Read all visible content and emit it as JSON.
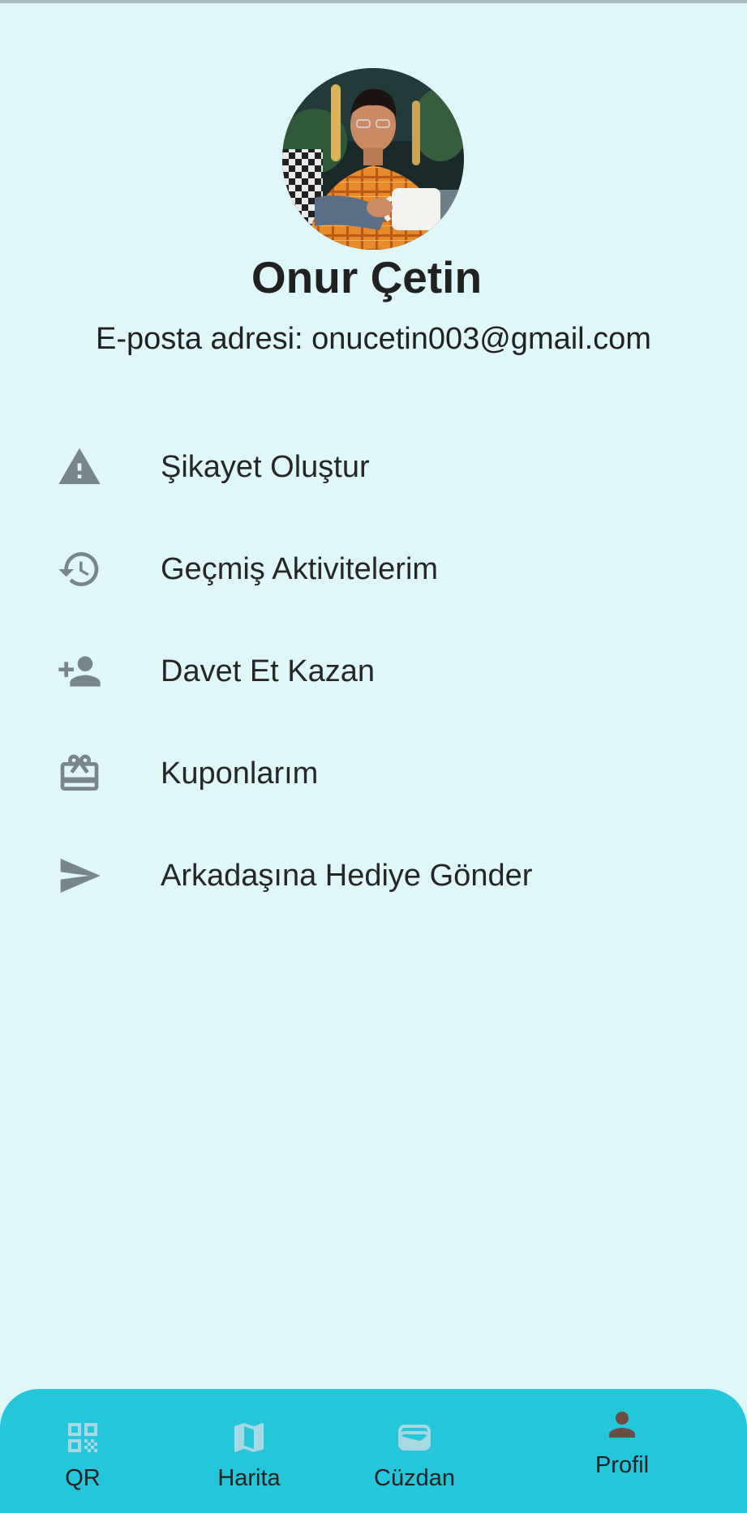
{
  "profile": {
    "name": "Onur Çetin",
    "email_line": "E-posta adresi: onucetin003@gmail.com"
  },
  "menu": {
    "items": [
      {
        "label": "Şikayet Oluştur",
        "icon": "warning-icon"
      },
      {
        "label": "Geçmiş Aktivitelerim",
        "icon": "history-icon"
      },
      {
        "label": "Davet Et Kazan",
        "icon": "person-add-icon"
      },
      {
        "label": "Kuponlarım",
        "icon": "card-giftcard-icon"
      },
      {
        "label": "Arkadaşına Hediye Gönder",
        "icon": "send-icon"
      }
    ]
  },
  "bottom_nav": {
    "items": [
      {
        "label": "QR",
        "icon": "qr-code-icon",
        "selected": false
      },
      {
        "label": "Harita",
        "icon": "map-icon",
        "selected": false
      },
      {
        "label": "Cüzdan",
        "icon": "wallet-icon",
        "selected": false
      },
      {
        "label": "Profil",
        "icon": "person-icon",
        "selected": true
      }
    ]
  },
  "colors": {
    "background": "#e0f7fa",
    "nav_background": "#26c6da",
    "menu_icon": "#78868a",
    "nav_icon_inactive": "#a7d9e2",
    "nav_icon_active": "#6d4c41",
    "text": "#212121"
  }
}
